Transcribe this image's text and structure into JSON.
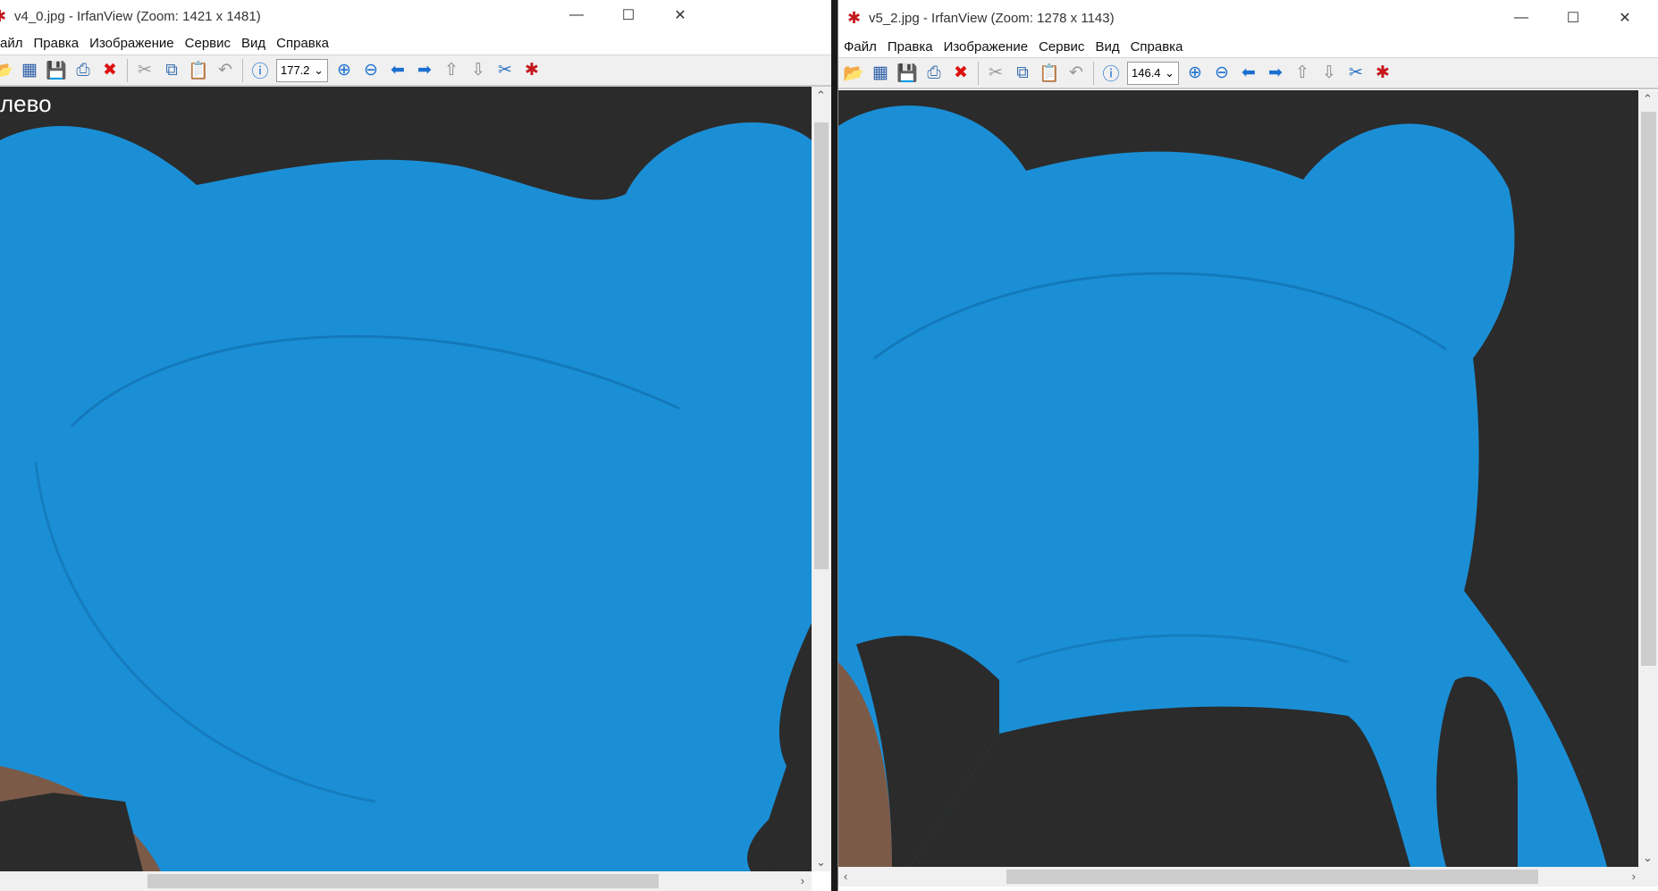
{
  "windows": [
    {
      "title": "v4_0.jpg - IrfanView (Zoom: 1421 x 1481)",
      "menu": [
        "айл",
        "Правка",
        "Изображение",
        "Сервис",
        "Вид",
        "Справка"
      ],
      "zoom_value": "177.2",
      "overlay_text": "лево"
    },
    {
      "title": "v5_2.jpg - IrfanView (Zoom: 1278 x 1143)",
      "menu": [
        "Файл",
        "Правка",
        "Изображение",
        "Сервис",
        "Вид",
        "Справка"
      ],
      "zoom_value": "146.4"
    }
  ],
  "colors": {
    "model": "#1b8fd6",
    "background": "#2b2b2b",
    "ground": "#7b5a48"
  }
}
